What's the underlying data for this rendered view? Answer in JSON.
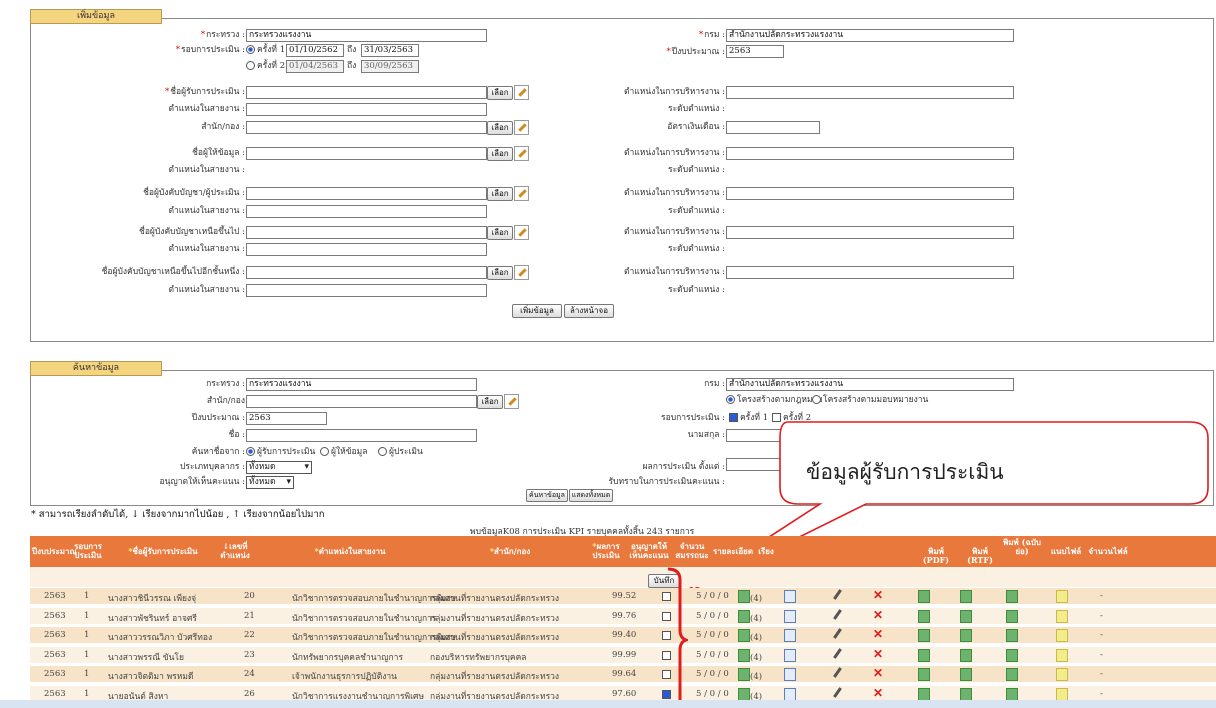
{
  "add_panel": {
    "tab": "เพิ่มข้อมูล",
    "ministry_label": "กระทรวง :",
    "ministry_value": "กระทรวงแรงงาน",
    "dept_label": "กรม :",
    "dept_value": "สำนักงานปลัดกระทรวงแรงงาน",
    "round_label": "รอบการประเมิน :",
    "round1_label": "ครั้งที่ 1",
    "round1_from": "01/10/2562",
    "to_label": "ถึง",
    "round1_to": "31/03/2563",
    "round2_label": "ครั้งที่ 2",
    "round2_from": "01/04/2563",
    "round2_to": "30/09/2563",
    "budget_year_label": "ปีงบประมาณ :",
    "budget_year_value": "2563",
    "evaluatee_label": "ชื่อผู้รับการประเมิน :",
    "line_position_label": "ตำแหน่งในสายงาน :",
    "admin_position_label": "ตำแหน่งในการบริหารงาน :",
    "position_level_label": "ระดับตำแหน่ง :",
    "office_label": "สำนัก/กอง :",
    "salary_rate_label": "อัตราเงินเดือน :",
    "informant_label": "ชื่อผู้ให้ข้อมูล :",
    "supervisor_label": "ชื่อผู้บังคับบัญชา/ผู้ประเมิน :",
    "higher_supervisor_label": "ชื่อผู้บังคับบัญชาเหนือขึ้นไป :",
    "higher_supervisor2_label": "ชื่อผู้บังคับบัญชาเหนือขึ้นไปอีกชั้นหนึ่ง :",
    "select_button": "เลือก",
    "add_button": "เพิ่มข้อมูล",
    "clear_button": "ล้างหน้าจอ"
  },
  "search_panel": {
    "tab": "ค้นหาข้อมูล",
    "ministry_label": "กระทรวง :",
    "ministry_value": "กระทรวงแรงงาน",
    "dept_label": "กรม :",
    "dept_value": "สำนักงานปลัดกระทรวงแรงงาน",
    "office_label": "สำนัก/กอง",
    "structure_law": "โครงสร้างตามกฎหมาย",
    "structure_assign": "โครงสร้างตามมอบหมายงาน",
    "budget_year_label": "ปีงบประมาณ :",
    "budget_year_value": "2563",
    "round_label": "รอบการประเมิน :",
    "round1": "ครั้งที่ 1",
    "round2": "ครั้งที่ 2",
    "name_label": "ชื่อ :",
    "surname_label": "นามสกุล :",
    "search_from_label": "ค้นหาชื่อจาก :",
    "opt_evaluatee": "ผู้รับการประเมิน",
    "opt_informant": "ผู้ให้ข้อมูล",
    "opt_evaluator": "ผู้ประเมิน",
    "personnel_type_label": "ประเภทบุคลากร :",
    "personnel_type_value": "ทั้งหมด",
    "allow_score_label": "อนุญาตให้เห็นคะแนน :",
    "allow_score_value": "ทั้งหมด",
    "result_from_label": "ผลการประเมิน ตั้งแต่ :",
    "acknowledge_label": "รับทราบในการประเมินคะแนน :",
    "search_button": "ค้นหาข้อมูล",
    "show_all_button": "แสดงทั้งหมด"
  },
  "sort_note": "* สามารถเรียงลำดับได้, ↓ เรียงจากมากไปน้อย , ↑ เรียงจากน้อยไปมาก",
  "result_summary": "พบข้อมูลK08 การประเมิน KPI รายบุคคลทั้งสิ้น 243 รายการ",
  "callout_text": "ข้อมูลผู้รับการประเมิน",
  "save_button": "บันทึก",
  "columns": {
    "year": "ปีงบประมาณ",
    "round": "รอบการประเมิน",
    "name": "ชื่อผู้รับการประเมิน",
    "pos_no": "เลขที่ตำแหน่ง",
    "position": "ตำแหน่งในสายงาน",
    "office": "สำนัก/กอง",
    "score": "ผลการประเมิน",
    "allow": "อนุญาตให้เห็นคะแนน",
    "competency": "จำนวนสมรรถนะ",
    "detail": "รายละเอียด",
    "order": "เรียง",
    "pdf": "พิมพ์ (PDF)",
    "rtf": "พิมพ์ (RTF)",
    "print_part": "พิมพ์ (ฉบับย่อ)",
    "attach": "แนบไฟล์",
    "file_count": "จำนวนไฟล์"
  },
  "rows": [
    {
      "year": "2563",
      "round": "1",
      "name": "นางสาวชินีวรรณ เพียงจุ่",
      "pos_no": "20",
      "position": "นักวิชาการตรวจสอบภายในชำนาญการพิเศษ",
      "office": "กลุ่มงานที่รายงานตรงปลัดกระทรวง",
      "score": "99.52",
      "competency": "5 / 0 / 0",
      "detail_count": "(4)",
      "file_count": "-",
      "allow": false
    },
    {
      "year": "2563",
      "round": "1",
      "name": "นางสาวพัชรินทร์ อาจศรี",
      "pos_no": "21",
      "position": "นักวิชาการตรวจสอบภายในชำนาญการ",
      "office": "กลุ่มงานที่รายงานตรงปลัดกระทรวง",
      "score": "99.76",
      "competency": "5 / 0 / 0",
      "detail_count": "(4)",
      "file_count": "-",
      "allow": false
    },
    {
      "year": "2563",
      "round": "1",
      "name": "นางสาววรรณวิภา บัวศรีทอง",
      "pos_no": "22",
      "position": "นักวิชาการตรวจสอบภายในชำนาญการพิเศษ",
      "office": "กลุ่มงานที่รายงานตรงปลัดกระทรวง",
      "score": "99.40",
      "competency": "5 / 0 / 0",
      "detail_count": "(4)",
      "file_count": "-",
      "allow": false
    },
    {
      "year": "2563",
      "round": "1",
      "name": "นางสาวพรรณี ขันโย",
      "pos_no": "23",
      "position": "นักทรัพยากรบุคคลชำนาญการ",
      "office": "กองบริหารทรัพยากรบุคคล",
      "score": "99.99",
      "competency": "5 / 0 / 0",
      "detail_count": "(4)",
      "file_count": "-",
      "allow": false
    },
    {
      "year": "2563",
      "round": "1",
      "name": "นางสาวจิตติมา พรหมดี",
      "pos_no": "24",
      "position": "เจ้าพนักงานธุรการปฏิบัติงาน",
      "office": "กลุ่มงานที่รายงานตรงปลัดกระทรวง",
      "score": "99.64",
      "competency": "5 / 0 / 0",
      "detail_count": "(4)",
      "file_count": "-",
      "allow": false
    },
    {
      "year": "2563",
      "round": "1",
      "name": "นายอนันต์ สิงหา",
      "pos_no": "26",
      "position": "นักวิชาการแรงงานชำนาญการพิเศษ",
      "office": "กลุ่มงานที่รายงานตรงปลัดกระทรวง",
      "score": "97.60",
      "competency": "5 / 0 / 0",
      "detail_count": "(4)",
      "file_count": "-",
      "allow": true
    }
  ],
  "colors": {
    "tab": "#f5d480",
    "header": "#e9783d",
    "row_odd": "#f7e4c8",
    "row_even": "#fbf1e2",
    "callout_border": "#e01c1c",
    "bracket": "#e01c1c"
  }
}
